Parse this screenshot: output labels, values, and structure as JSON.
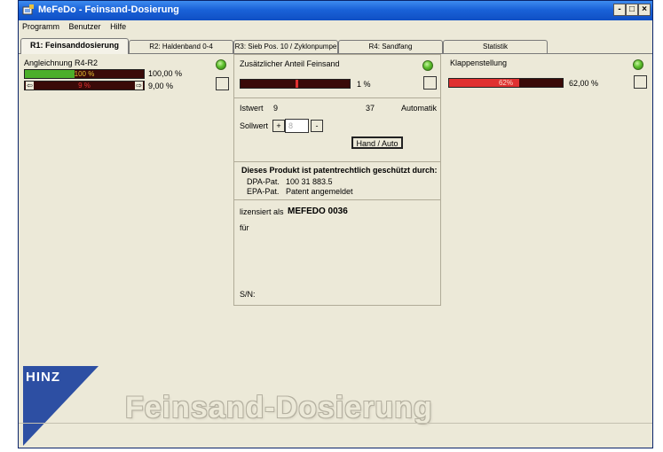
{
  "window": {
    "title": "MeFeDo - Feinsand-Dosierung",
    "btn_min": "-",
    "btn_max": "□",
    "btn_close": "×"
  },
  "menu": [
    "Programm",
    "Benutzer",
    "Hilfe"
  ],
  "tabs": [
    {
      "label": "R1: Feinsanddosierung",
      "active": true
    },
    {
      "label": "R2: Haldenband 0-4",
      "active": false
    },
    {
      "label": "R3: Sieb Pos. 10 / Zyklonpumpe",
      "active": false
    },
    {
      "label": "R4: Sandfang",
      "active": false
    },
    {
      "label": "Statistik",
      "active": false
    }
  ],
  "left": {
    "title": "Angleichnung R4-R2",
    "bar1": {
      "text": "100 %",
      "value_label": "100,00 %",
      "level": 0.42,
      "color": "#4caf2a"
    },
    "bar2": {
      "text": "9 %",
      "value_label": "9,00 %",
      "level": 0.09,
      "color": "#3a0a08",
      "left_icon": "⇦",
      "right_icon": "⇨"
    }
  },
  "middle": {
    "title": "Zusätzlicher Anteil Feinsand",
    "bar": {
      "value_label": "1 %",
      "marker": 0.5,
      "color": "#e03030"
    },
    "istwert_label": "Istwert",
    "istwert_val1": "9",
    "istwert_val2": "37",
    "mode": "Automatik",
    "sollwert_label": "Sollwert",
    "plus": "+",
    "minus": "-",
    "sollwert_value": "8",
    "hand_auto": "Hand / Auto",
    "patent_title": "Dieses Produkt ist patentrechtlich geschützt durch:",
    "patent_rows": [
      {
        "k": "DPA-Pat.",
        "v": "100 31 883.5"
      },
      {
        "k": "EPA-Pat.",
        "v": "Patent angemeldet"
      }
    ],
    "license_label": "lizensiert als",
    "license_value": "MEFEDO 0036",
    "fuer": "für",
    "sn": "S/N:"
  },
  "right": {
    "title": "Klappenstellung",
    "bar": {
      "text": "62%",
      "value_label": "62,00 %",
      "level": 0.62,
      "color": "#e03030"
    }
  },
  "logo": {
    "brand": "HINZ",
    "brand_bg": "#2d4fa3",
    "caption": "Feinsand-Dosierung"
  }
}
